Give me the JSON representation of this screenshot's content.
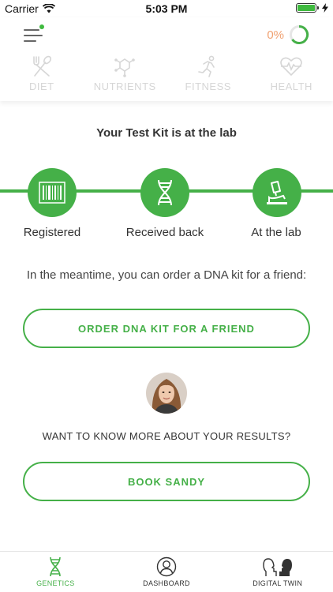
{
  "status_bar": {
    "carrier": "Carrier",
    "time": "5:03 PM"
  },
  "header": {
    "progress_text": "0%",
    "tabs": [
      {
        "label": "DIET",
        "icon": "fork-spoon-icon"
      },
      {
        "label": "NUTRIENTS",
        "icon": "molecule-icon"
      },
      {
        "label": "FITNESS",
        "icon": "runner-icon"
      },
      {
        "label": "HEALTH",
        "icon": "heartbeat-icon"
      }
    ]
  },
  "main": {
    "title": "Your Test Kit is at the lab",
    "steps": [
      {
        "label": "Registered",
        "icon": "barcode-icon"
      },
      {
        "label": "Received back",
        "icon": "dna-icon"
      },
      {
        "label": "At the lab",
        "icon": "microscope-icon"
      }
    ],
    "meantime_text": "In the meantime, you can order a DNA kit for a friend:",
    "order_button": "ORDER DNA KIT FOR A FRIEND",
    "know_more_text": "WANT TO KNOW MORE ABOUT YOUR RESULTS?",
    "book_button": "BOOK SANDY"
  },
  "bottom_nav": [
    {
      "label": "GENETICS",
      "icon": "dna-icon",
      "active": true
    },
    {
      "label": "DASHBOARD",
      "icon": "user-circle-icon",
      "active": false
    },
    {
      "label": "DIGITAL TWIN",
      "icon": "twin-heads-icon",
      "active": false
    }
  ],
  "colors": {
    "accent": "#45b048",
    "progress_text": "#f0a070",
    "inactive_tab": "#d6d6d6"
  }
}
